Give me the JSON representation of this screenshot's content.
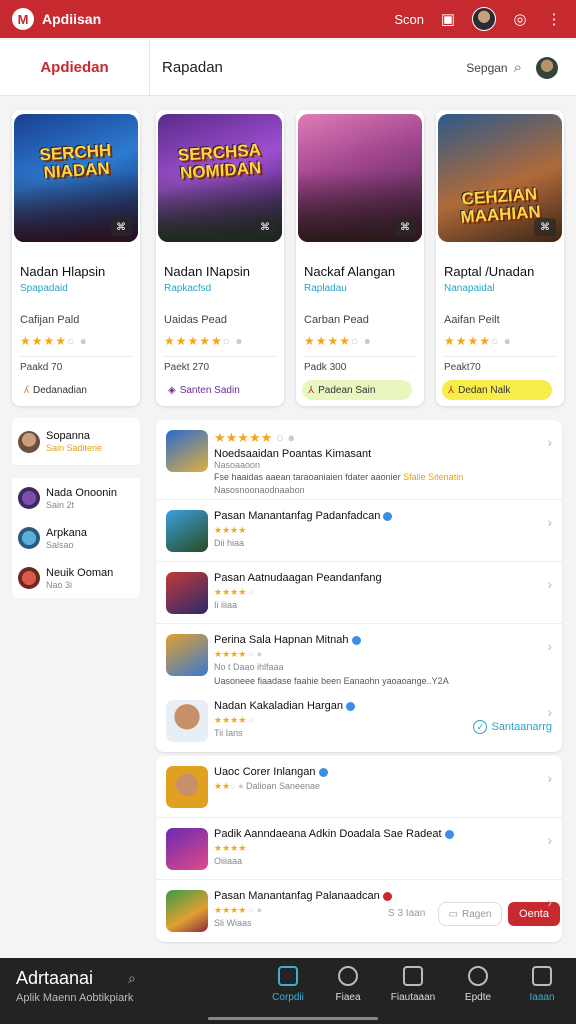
{
  "topbar": {
    "title": "Apdiisan",
    "user_label": "Scon"
  },
  "subheader": {
    "brand": "Apdiedan",
    "page": "Rapadan",
    "search_label": "Sepgan"
  },
  "cards": [
    {
      "art_text": "SERCHH NIADAN",
      "title": "Nadan Hlapsin",
      "subtitle": "Spapadaid",
      "meta": "Cafijan Pald",
      "stars": 4,
      "price": "Paakd 70",
      "pill": "Dedanadian"
    },
    {
      "art_text": "SERCHSA NOMIDAN",
      "title": "Nadan INapsin",
      "subtitle": "Rapkacfsd",
      "meta": "Uaidas Pead",
      "stars": 5,
      "price": "Paekt 270",
      "pill": "Santen Sadin"
    },
    {
      "art_text": "",
      "title": "Nackaf Alangan",
      "subtitle": "Rapladau",
      "meta": "Carban Pead",
      "stars": 4,
      "price": "Padk 300",
      "pill": "Padean Sain"
    },
    {
      "art_text": "CEHZIAN MAAHIAN",
      "title": "Raptal /Unadan",
      "subtitle": "Nanapaidal",
      "meta": "Aaifan Peilt",
      "stars": 4,
      "price": "Peakt70",
      "pill": "Dedan Nalk"
    }
  ],
  "left_list": [
    {
      "name": "Sopanna",
      "sub": "Sain Saditerie"
    },
    {
      "name": "Nada Onoonin",
      "sub": "Sain 2t"
    },
    {
      "name": "Arpkana",
      "sub": "Salsao"
    },
    {
      "name": "Neuik Ooman",
      "sub": "Nao 3i"
    }
  ],
  "list1": [
    {
      "title": "Noedsaaidan Poantas Kimasant",
      "meta": "Nasoaaoon",
      "desc": "Fse haaidas aaean taraoaniaien fdater aaonier",
      "tag": "Sfalie Sitenatin",
      "desc2": "Nasosnoonaodnaabon"
    },
    {
      "title": "Pasan Manantanfag Padanfadcan",
      "meta": "Dii hiaa"
    },
    {
      "title": "Pasan Aatnudaagan Peandanfang",
      "meta": "Ii iiiaa"
    },
    {
      "title": "Perina Sala Hapnan Mitnah",
      "meta": "No t Daao ihlfaaa",
      "desc": "Uasoneee fiaadase faahie been Eanaohn yaoaoange..Y2A"
    },
    {
      "title": "Nadan Kakaladian Hargan",
      "meta": "Tii Ians",
      "action": "Santaanarrg"
    }
  ],
  "list2": [
    {
      "title": "Uaoc Corer Inlangan",
      "meta": "Dalioan Saneenae"
    },
    {
      "title": "Padik Aanndaeana Adkin Doadala Sae Radeat",
      "meta": "Oiiiaaa"
    },
    {
      "title": "Pasan Manantanfag Palanaadcan",
      "meta": "Sli Wiaas",
      "meta2": "S 3 Iaan",
      "btn_outline": "Ragen",
      "btn_red": "Oenta"
    }
  ],
  "bottom": {
    "name": "Adrtaanai",
    "sub": "Aplik Maenn   Aobtikpiark",
    "nav": [
      "Corpdii",
      "Fiaea",
      "Fiautaaan",
      "Epdte",
      "Iaaan"
    ]
  },
  "colors": {
    "brand_red": "#c62a2f",
    "accent_blue": "#3bb0d6",
    "star": "#f3a61a"
  }
}
